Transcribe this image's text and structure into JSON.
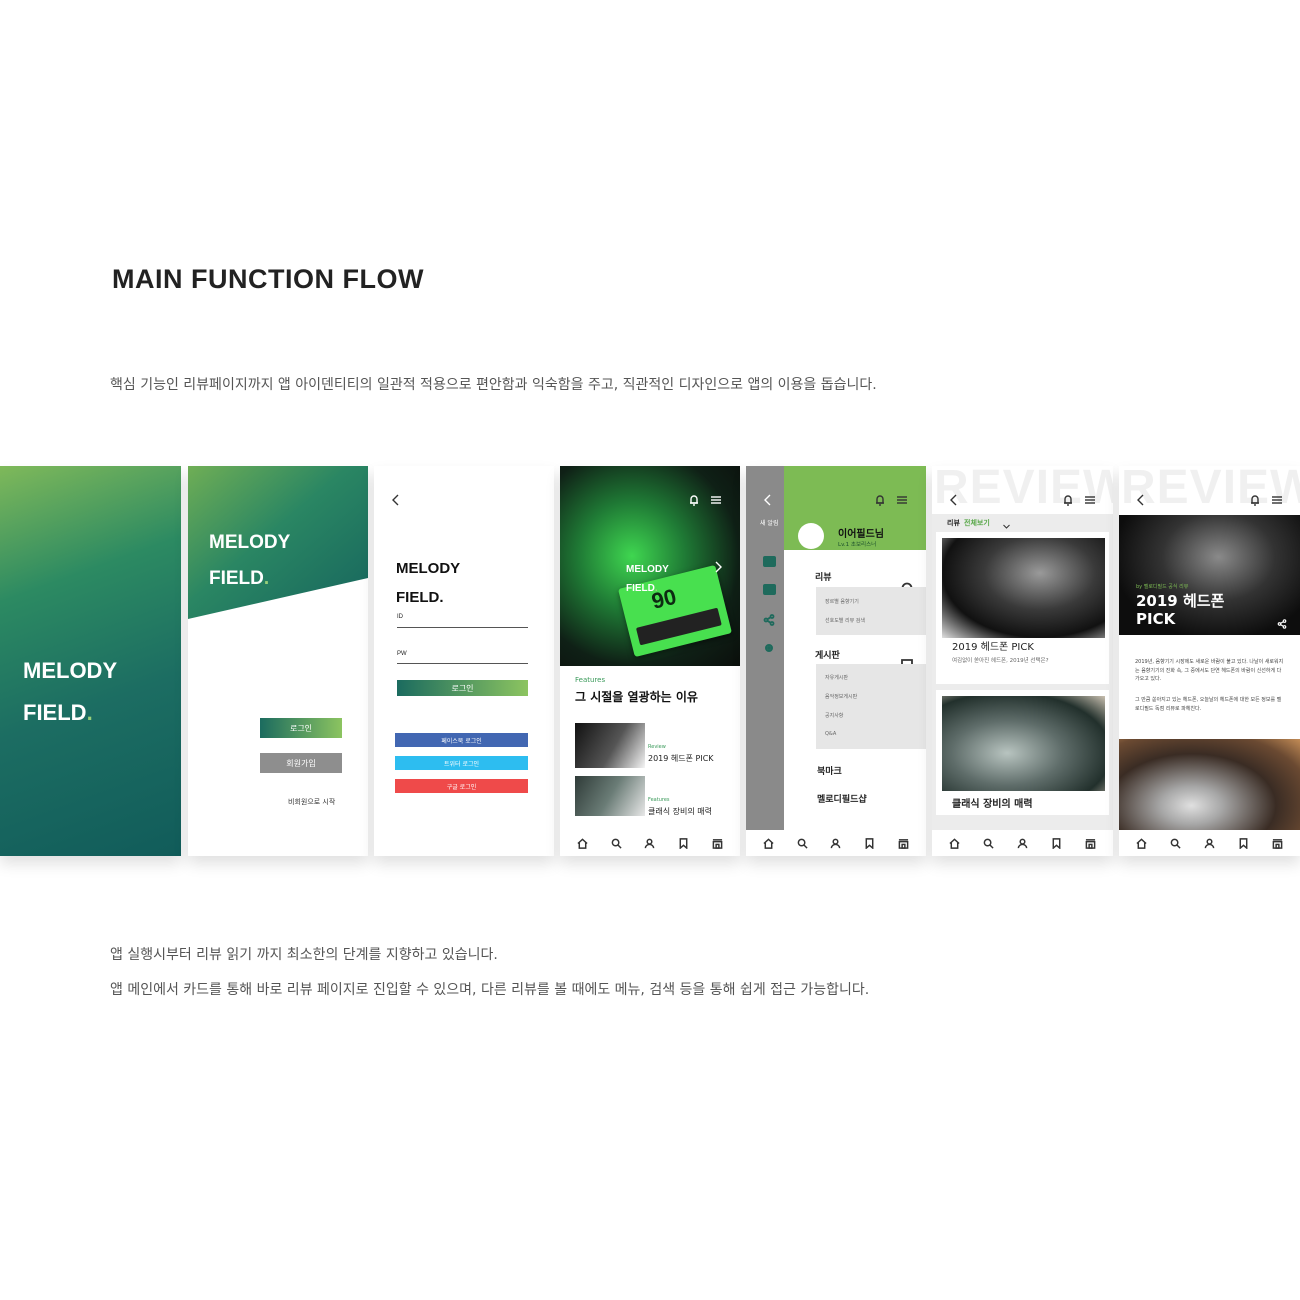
{
  "header": {
    "title": "MAIN FUNCTION FLOW",
    "description": "핵심 기능인 리뷰페이지까지 앱 아이덴티티의 일관적 적용으로 편안함과 익숙함을 주고, 직관적인 디자인으로 앱의 이용을 돕습니다."
  },
  "footer": {
    "line1": "앱 실행시부터 리뷰 읽기 까지 최소한의 단계를 지향하고 있습니다.",
    "line2": "앱 메인에서 카드를 통해 바로 리뷰 페이지로 진입할 수 있으며, 다른 리뷰를 볼 때에도 메뉴, 검색 등을 통해 쉽게 접근 가능합니다."
  },
  "brand": {
    "line1": "MELODY",
    "line2": "FIELD",
    "dot": ".",
    "accent": "#7dbb54",
    "primary": "#1c6d62"
  },
  "screen2": {
    "login_button": "로그인",
    "signup_button": "회원가입",
    "guest_link": "비회원으로 시작"
  },
  "screen3": {
    "id_label": "ID",
    "pw_label": "PW",
    "login_button": "로그인",
    "facebook_button": "페이스북 로그인",
    "twitter_button": "트위터 로그인",
    "google_button": "구글 로그인",
    "colors": {
      "facebook": "#4267b2",
      "twitter": "#2dbdf0",
      "google": "#ef4a4a"
    }
  },
  "screen4": {
    "card_tag": "Features",
    "card_title": "그 시절을 열광하는 이유",
    "list": [
      {
        "tag": "Review",
        "title": "2019 헤드폰 PICK"
      },
      {
        "tag": "Features",
        "title": "클래식 장비의 매력"
      }
    ]
  },
  "screen5": {
    "bg_text": "새 알림",
    "user_name": "이어필드님",
    "user_level": "Lv.1 초보리스너",
    "sections": [
      {
        "title": "리뷰",
        "items": [
          "장르별 음향기기",
          "선호도별 리뷰 검색"
        ]
      },
      {
        "title": "게시판",
        "items": [
          "자유게시판",
          "음악정보게시판",
          "공지사항",
          "Q&A"
        ]
      }
    ],
    "bookmark": "북마크",
    "shop": "멜로디필드샵"
  },
  "screen6": {
    "watermark": "REVIEW",
    "filter_label": "리뷰",
    "filter_value": "전체보기",
    "cards": [
      {
        "title": "2019 헤드폰 PICK",
        "subtitle": "여김없이 쏟아진 헤드폰, 2019년 선택은?"
      },
      {
        "title": "클래식 장비의 매력"
      }
    ]
  },
  "screen7": {
    "watermark": "REVIEW",
    "tag": "by 멜로디필드 공식 리뷰",
    "title_line1": "2019 헤드폰",
    "title_line2": "PICK",
    "paragraph1": "2019년, 음향기기 시장에도 새로운 바람이 불고 있다. 나날이 새로워지는 음향기기의 진화 속, 그 중에서도 단연 헤드폰의 바람이 신선하게 다가오고 있다.",
    "paragraph2": "그 만큼 쏟아지고 있는 헤드폰, 오늘날의 헤드폰에 대한 모든 정보를 멜로디필드 독점 리뷰로 파헤친다."
  }
}
